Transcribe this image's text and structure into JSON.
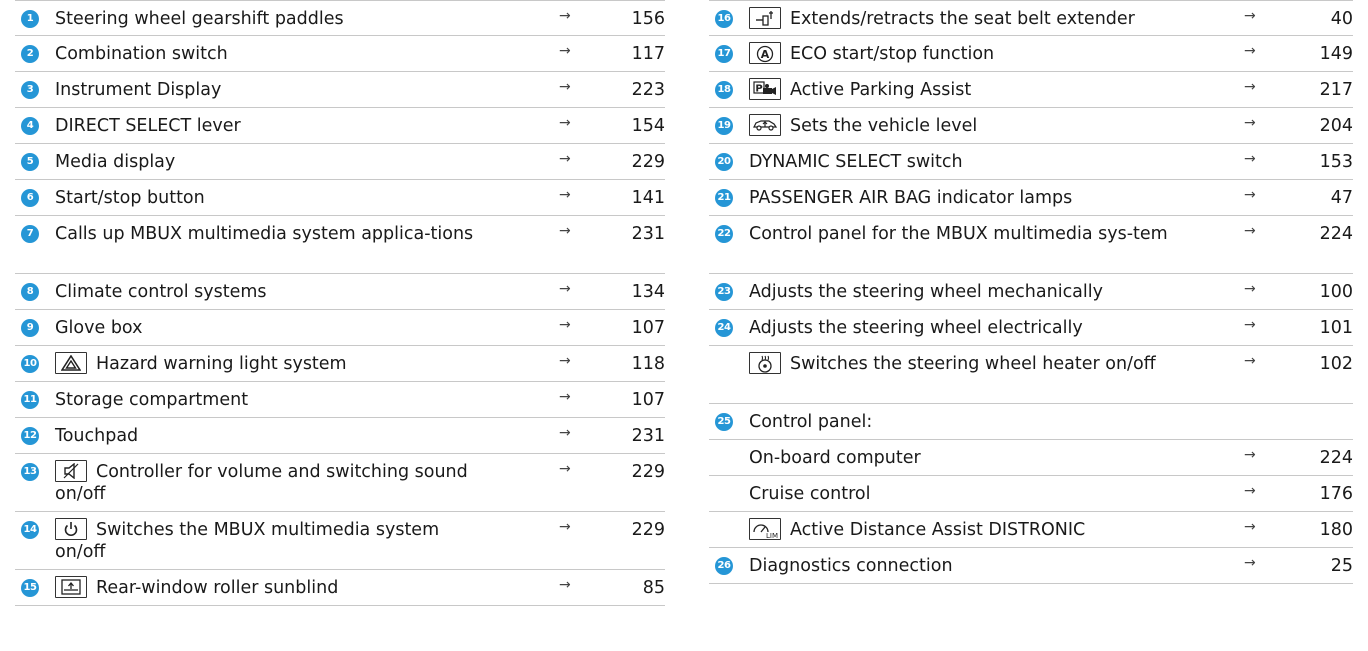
{
  "arrow_glyph": "→",
  "accent_color": "#2596d6",
  "left": [
    {
      "num": "1",
      "text": "Steering wheel gearshift paddles",
      "page": "156",
      "icon": null,
      "lines": 1
    },
    {
      "num": "2",
      "text": "Combination switch",
      "page": "117",
      "icon": null,
      "lines": 1
    },
    {
      "num": "3",
      "text": "Instrument Display",
      "page": "223",
      "icon": null,
      "lines": 1
    },
    {
      "num": "4",
      "text": "DIRECT SELECT lever",
      "page": "154",
      "icon": null,
      "lines": 1
    },
    {
      "num": "5",
      "text": "Media display",
      "page": "229",
      "icon": null,
      "lines": 1
    },
    {
      "num": "6",
      "text": "Start/stop button",
      "page": "141",
      "icon": null,
      "lines": 1
    },
    {
      "num": "7",
      "text": "Calls up MBUX multimedia system applica-tions",
      "page": "231",
      "icon": null,
      "lines": 2
    },
    {
      "num": "8",
      "text": "Climate control systems",
      "page": "134",
      "icon": null,
      "lines": 1
    },
    {
      "num": "9",
      "text": "Glove box",
      "page": "107",
      "icon": null,
      "lines": 1
    },
    {
      "num": "10",
      "text": "Hazard warning light system",
      "page": "118",
      "icon": "hazard-icon",
      "lines": 1
    },
    {
      "num": "11",
      "text": "Storage compartment",
      "page": "107",
      "icon": null,
      "lines": 1
    },
    {
      "num": "12",
      "text": "Touchpad",
      "page": "231",
      "icon": null,
      "lines": 1
    },
    {
      "num": "13",
      "text": "Controller for volume and switching sound on/off",
      "page": "229",
      "icon": "mute-icon",
      "lines": 2
    },
    {
      "num": "14",
      "text": "Switches the MBUX multimedia system on/off",
      "page": "229",
      "icon": "power-icon",
      "lines": 2
    },
    {
      "num": "15",
      "text": "Rear-window roller sunblind",
      "page": "85",
      "icon": "sunblind-icon",
      "lines": 1
    }
  ],
  "right": [
    {
      "num": "16",
      "text": "Extends/retracts the seat belt extender",
      "page": "40",
      "icon": "seatbelt-icon",
      "lines": 1
    },
    {
      "num": "17",
      "text": "ECO start/stop function",
      "page": "149",
      "icon": "eco-icon",
      "lines": 1
    },
    {
      "num": "18",
      "text": "Active Parking Assist",
      "page": "217",
      "icon": "parking-icon",
      "lines": 1
    },
    {
      "num": "19",
      "text": "Sets the vehicle level",
      "page": "204",
      "icon": "vehicle-level-icon",
      "lines": 1
    },
    {
      "num": "20",
      "text": "DYNAMIC SELECT switch",
      "page": "153",
      "icon": null,
      "lines": 1
    },
    {
      "num": "21",
      "text": "PASSENGER AIR BAG indicator lamps",
      "page": "47",
      "icon": null,
      "lines": 1
    },
    {
      "num": "22",
      "text": "Control panel for the MBUX multimedia sys-tem",
      "page": "224",
      "icon": null,
      "lines": 2
    },
    {
      "num": "23",
      "text": "Adjusts the steering wheel mechanically",
      "page": "100",
      "icon": null,
      "lines": 1
    },
    {
      "num": "24",
      "text": "Adjusts the steering wheel electrically",
      "page": "101",
      "icon": null,
      "lines": 1
    },
    {
      "num": "",
      "text": "Switches the steering wheel heater on/off",
      "page": "102",
      "icon": "wheel-heater-icon",
      "lines": 2
    },
    {
      "num": "25",
      "text": "Control panel:",
      "page": "",
      "icon": null,
      "lines": 1
    },
    {
      "num": "",
      "text": "On-board computer",
      "page": "224",
      "icon": null,
      "lines": 1
    },
    {
      "num": "",
      "text": "Cruise control",
      "page": "176",
      "icon": null,
      "lines": 1
    },
    {
      "num": "",
      "text": "Active Distance Assist DISTRONIC",
      "page": "180",
      "icon": "distronic-icon",
      "lines": 1
    },
    {
      "num": "26",
      "text": "Diagnostics connection",
      "page": "25",
      "icon": null,
      "lines": 1
    }
  ]
}
